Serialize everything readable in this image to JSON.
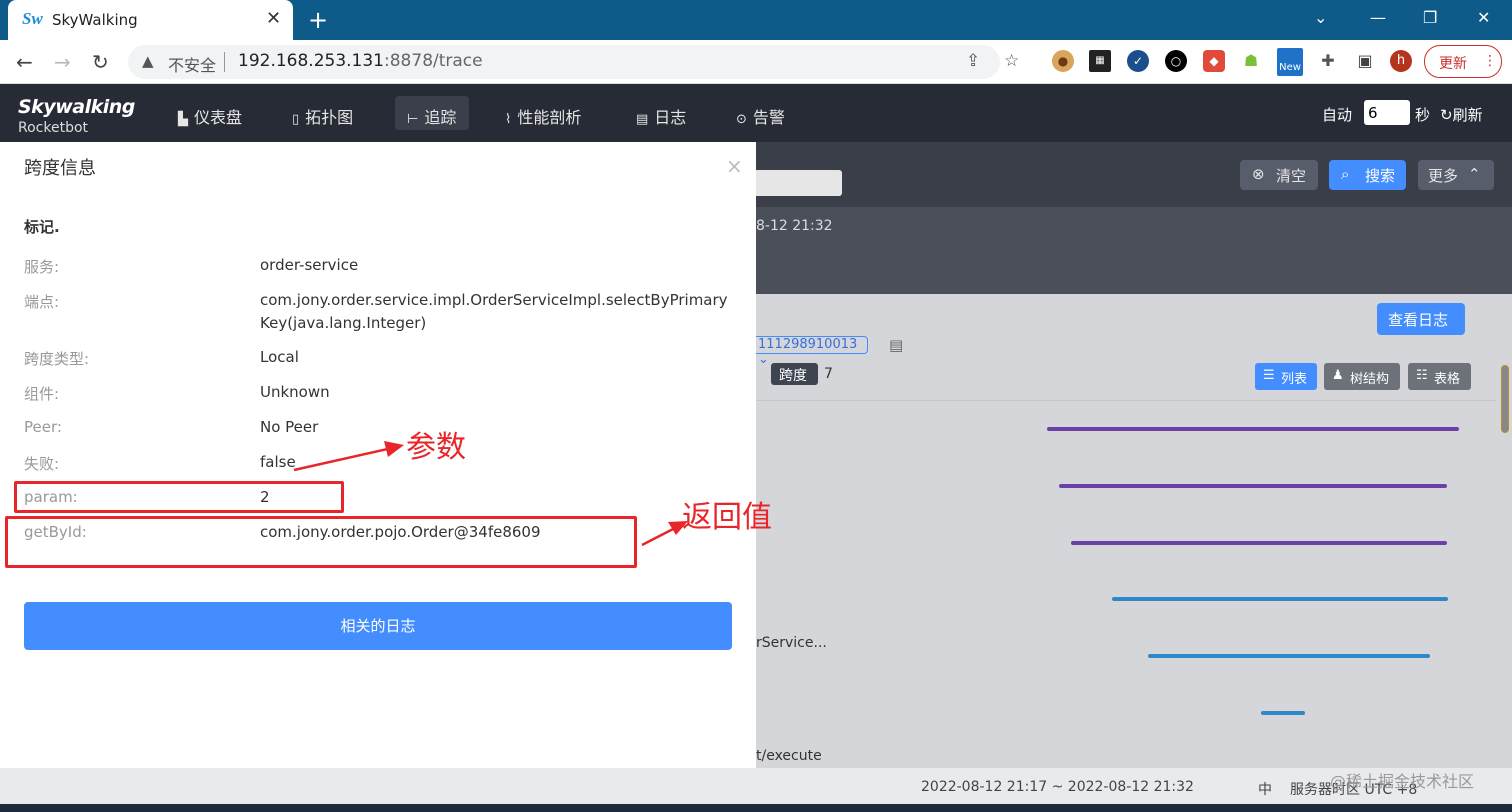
{
  "browser": {
    "tab_title": "SkyWalking",
    "favicon_text": "Sw",
    "insecure_label": "不安全",
    "url_host": "192.168.253.131",
    "url_rest": ":8878/trace",
    "update_label": "更新",
    "ext_new_badge": "New",
    "profile_letter": "h"
  },
  "app": {
    "logo_main": "Skywalking",
    "logo_sub": "Rocketbot",
    "nav": [
      {
        "icon": "dashboard-icon",
        "label": "仪表盘"
      },
      {
        "icon": "topology-icon",
        "label": "拓扑图"
      },
      {
        "icon": "trace-icon",
        "label": "追踪"
      },
      {
        "icon": "profile-icon",
        "label": "性能剖析"
      },
      {
        "icon": "log-icon",
        "label": "日志"
      },
      {
        "icon": "alarm-icon",
        "label": "告警"
      }
    ],
    "active_nav": "追踪",
    "auto_label": "自动",
    "auto_value": "6",
    "seconds_label": "秒",
    "refresh_label": "刷新"
  },
  "background": {
    "clear_label": "清空",
    "search_label": "搜索",
    "more_label": "更多",
    "date_fragment": "8-12 21:32",
    "view_log_label": "查看日志",
    "trace_id_fragment": "111298910013",
    "span_label": "跨度",
    "span_count": "7",
    "view_list": "列表",
    "view_tree": "树结构",
    "view_table": "表格",
    "text_service_fragment": "rService...",
    "text_execute_fragment": "t/execute",
    "footer_time_range": "2022-08-12 21:17 ~ 2022-08-12 21:32",
    "footer_lang": "中",
    "footer_tz": "服务器时区 UTC +8",
    "watermark": "@稀土掘金技术社区"
  },
  "modal": {
    "title": "跨度信息",
    "section": "标记.",
    "rows": [
      {
        "key": "服务:",
        "value": "order-service"
      },
      {
        "key": "端点:",
        "value": "com.jony.order.service.impl.OrderServiceImpl.selectByPrimaryKey(java.lang.Integer)"
      },
      {
        "key": "跨度类型:",
        "value": "Local"
      },
      {
        "key": "组件:",
        "value": "Unknown"
      },
      {
        "key": "Peer:",
        "value": "No Peer"
      },
      {
        "key": "失败:",
        "value": "false"
      },
      {
        "key": "param:",
        "value": "2"
      },
      {
        "key": "getById:",
        "value": "com.jony.order.pojo.Order@34fe8609"
      }
    ],
    "related_logs_label": "相关的日志"
  },
  "annotations": {
    "param_label": "参数",
    "return_label": "返回值"
  },
  "colors": {
    "browser_frame": "#0e5b8a",
    "app_header": "#272b35",
    "primary": "#448dfe",
    "annotation_red": "#e8262a",
    "bar_purple": "#6b3fa8",
    "bar_blue": "#2f87c7"
  }
}
